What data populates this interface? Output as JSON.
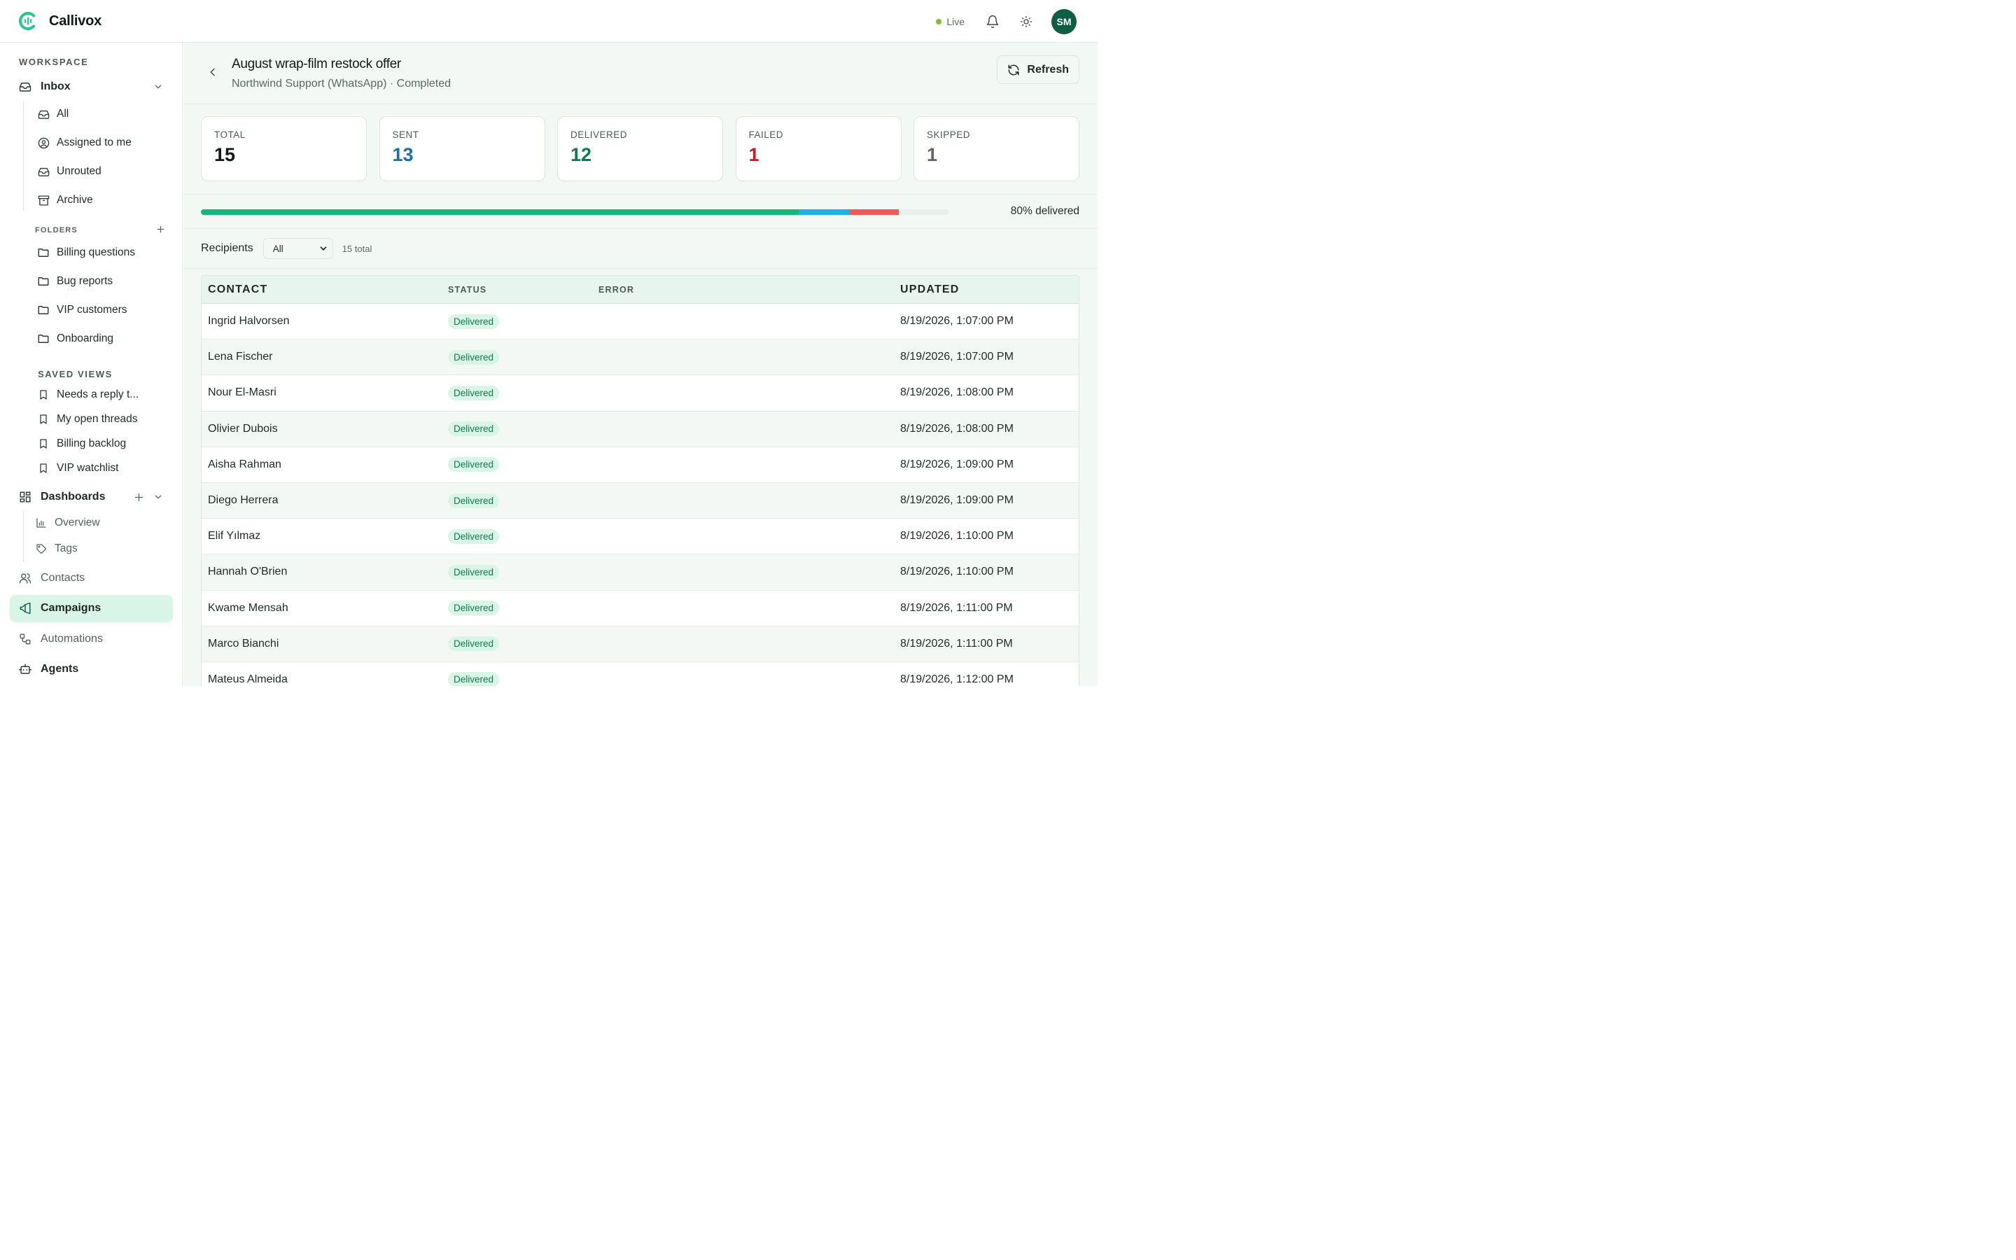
{
  "app": {
    "name": "Callivox",
    "brand_color": "#22c98a"
  },
  "topbar": {
    "live_label": "Live",
    "live_color": "#7fbf2e",
    "avatar_initials": "SM",
    "icons": [
      "bell-icon",
      "sun-icon"
    ]
  },
  "sidebar": {
    "workspace_title": "WORKSPACE",
    "inbox": {
      "label": "Inbox",
      "items": [
        {
          "label": "All",
          "icon": "inbox-icon"
        },
        {
          "label": "Assigned to me",
          "icon": "user-circle-icon"
        },
        {
          "label": "Unrouted",
          "icon": "inbox-icon"
        },
        {
          "label": "Archive",
          "icon": "archive-icon"
        }
      ]
    },
    "folders": {
      "title": "FOLDERS",
      "items": [
        "Billing questions",
        "Bug reports",
        "VIP customers",
        "Onboarding"
      ]
    },
    "saved_views": {
      "title": "SAVED VIEWS",
      "items": [
        "Needs a reply t...",
        "My open threads",
        "Billing backlog",
        "VIP watchlist"
      ]
    },
    "dashboards": {
      "label": "Dashboards",
      "items": [
        {
          "label": "Overview",
          "icon": "bar-chart-icon"
        },
        {
          "label": "Tags",
          "icon": "tag-icon"
        }
      ]
    },
    "contacts_label": "Contacts",
    "campaigns_label": "Campaigns",
    "automations_label": "Automations",
    "agents_label": "Agents"
  },
  "header": {
    "title": "August wrap-film restock offer",
    "subtitle": "Northwind Support (WhatsApp) · Completed",
    "refresh_label": "Refresh"
  },
  "stats": [
    {
      "label": "TOTAL",
      "value": "15",
      "color": "#121a16"
    },
    {
      "label": "SENT",
      "value": "13",
      "color": "#1a6fa8"
    },
    {
      "label": "DELIVERED",
      "value": "12",
      "color": "#0f7a52"
    },
    {
      "label": "FAILED",
      "value": "1",
      "color": "#d9141f"
    },
    {
      "label": "SKIPPED",
      "value": "1",
      "color": "#5b6b62"
    }
  ],
  "progress": {
    "label": "80% delivered",
    "segments": [
      {
        "name": "delivered",
        "fraction": 0.8,
        "color": "#13b87a"
      },
      {
        "name": "sent",
        "fraction": 0.0667,
        "color": "#1fb0e6"
      },
      {
        "name": "failed",
        "fraction": 0.0667,
        "color": "#f25a5a"
      }
    ]
  },
  "recipients": {
    "label": "Recipients",
    "filter_value": "All",
    "count_label": "15 total"
  },
  "table": {
    "columns": [
      "CONTACT",
      "STATUS",
      "ERROR",
      "UPDATED"
    ],
    "rows": [
      {
        "contact": "Ingrid Halvorsen",
        "status": "Delivered",
        "error": "",
        "updated": "8/19/2026, 1:07:00 PM"
      },
      {
        "contact": "Lena Fischer",
        "status": "Delivered",
        "error": "",
        "updated": "8/19/2026, 1:07:00 PM"
      },
      {
        "contact": "Nour El-Masri",
        "status": "Delivered",
        "error": "",
        "updated": "8/19/2026, 1:08:00 PM"
      },
      {
        "contact": "Olivier Dubois",
        "status": "Delivered",
        "error": "",
        "updated": "8/19/2026, 1:08:00 PM"
      },
      {
        "contact": "Aisha Rahman",
        "status": "Delivered",
        "error": "",
        "updated": "8/19/2026, 1:09:00 PM"
      },
      {
        "contact": "Diego Herrera",
        "status": "Delivered",
        "error": "",
        "updated": "8/19/2026, 1:09:00 PM"
      },
      {
        "contact": "Elif Yılmaz",
        "status": "Delivered",
        "error": "",
        "updated": "8/19/2026, 1:10:00 PM"
      },
      {
        "contact": "Hannah O'Brien",
        "status": "Delivered",
        "error": "",
        "updated": "8/19/2026, 1:10:00 PM"
      },
      {
        "contact": "Kwame Mensah",
        "status": "Delivered",
        "error": "",
        "updated": "8/19/2026, 1:11:00 PM"
      },
      {
        "contact": "Marco Bianchi",
        "status": "Delivered",
        "error": "",
        "updated": "8/19/2026, 1:11:00 PM"
      },
      {
        "contact": "Mateus Almeida",
        "status": "Delivered",
        "error": "",
        "updated": "8/19/2026, 1:12:00 PM"
      }
    ]
  }
}
